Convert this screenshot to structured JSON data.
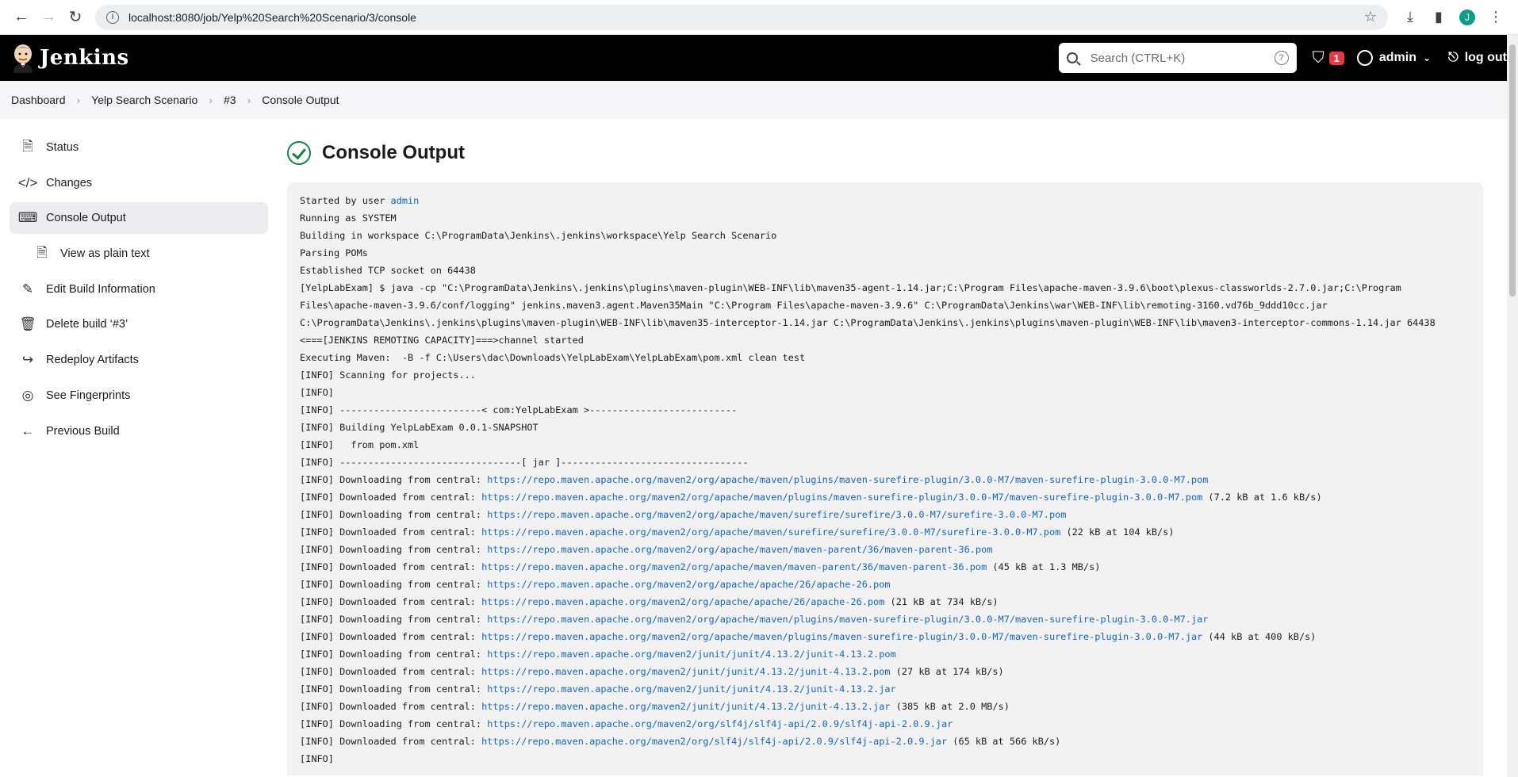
{
  "browser": {
    "url": "localhost:8080/job/Yelp%20Search%20Scenario/3/console",
    "profile_initial": "J"
  },
  "header": {
    "brand": "Jenkins",
    "search_placeholder": "Search (CTRL+K)",
    "alert_count": "1",
    "user": "admin",
    "logout": "log out"
  },
  "breadcrumb": [
    "Dashboard",
    "Yelp Search Scenario",
    "#3",
    "Console Output"
  ],
  "sidebar": {
    "items": [
      {
        "label": "Status",
        "icon": "document-icon"
      },
      {
        "label": "Changes",
        "icon": "code-icon"
      },
      {
        "label": "Console Output",
        "icon": "terminal-icon"
      },
      {
        "label": "View as plain text",
        "icon": "document-icon"
      },
      {
        "label": "Edit Build Information",
        "icon": "edit-icon"
      },
      {
        "label": "Delete build ‘#3’",
        "icon": "trash-icon"
      },
      {
        "label": "Redeploy Artifacts",
        "icon": "share-icon"
      },
      {
        "label": "See Fingerprints",
        "icon": "fingerprint-icon"
      },
      {
        "label": "Previous Build",
        "icon": "arrow-left-icon"
      }
    ]
  },
  "page": {
    "title": "Console Output",
    "status_color": "#138347"
  },
  "console": {
    "lines": [
      {
        "text": "Started by user ",
        "link": "admin",
        "suffix": ""
      },
      {
        "text": "Running as SYSTEM"
      },
      {
        "text": "Building in workspace C:\\ProgramData\\Jenkins\\.jenkins\\workspace\\Yelp Search Scenario"
      },
      {
        "text": "Parsing POMs"
      },
      {
        "text": "Established TCP socket on 64438"
      },
      {
        "text": "[YelpLabExam] $ java -cp \"C:\\ProgramData\\Jenkins\\.jenkins\\plugins\\maven-plugin\\WEB-INF\\lib\\maven35-agent-1.14.jar;C:\\Program Files\\apache-maven-3.9.6\\boot\\plexus-classworlds-2.7.0.jar;C:\\Program"
      },
      {
        "text": "Files\\apache-maven-3.9.6/conf/logging\" jenkins.maven3.agent.Maven35Main \"C:\\Program Files\\apache-maven-3.9.6\" C:\\ProgramData\\Jenkins\\war\\WEB-INF\\lib\\remoting-3160.vd76b_9ddd10cc.jar"
      },
      {
        "text": "C:\\ProgramData\\Jenkins\\.jenkins\\plugins\\maven-plugin\\WEB-INF\\lib\\maven35-interceptor-1.14.jar C:\\ProgramData\\Jenkins\\.jenkins\\plugins\\maven-plugin\\WEB-INF\\lib\\maven3-interceptor-commons-1.14.jar 64438"
      },
      {
        "text": "<===[JENKINS REMOTING CAPACITY]===>channel started"
      },
      {
        "text": "Executing Maven:  -B -f C:\\Users\\dac\\Downloads\\YelpLabExam\\YelpLabExam\\pom.xml clean test"
      },
      {
        "text": "[INFO] Scanning for projects..."
      },
      {
        "text": "[INFO]"
      },
      {
        "text": "[INFO] -------------------------< com:YelpLabExam >--------------------------"
      },
      {
        "text": "[INFO] Building YelpLabExam 0.0.1-SNAPSHOT"
      },
      {
        "text": "[INFO]   from pom.xml"
      },
      {
        "text": "[INFO] --------------------------------[ jar ]---------------------------------"
      },
      {
        "text": "[INFO] Downloading from central: ",
        "link": "https://repo.maven.apache.org/maven2/org/apache/maven/plugins/maven-surefire-plugin/3.0.0-M7/maven-surefire-plugin-3.0.0-M7.pom",
        "suffix": ""
      },
      {
        "text": "[INFO] Downloaded from central: ",
        "link": "https://repo.maven.apache.org/maven2/org/apache/maven/plugins/maven-surefire-plugin/3.0.0-M7/maven-surefire-plugin-3.0.0-M7.pom",
        "suffix": " (7.2 kB at 1.6 kB/s)"
      },
      {
        "text": "[INFO] Downloading from central: ",
        "link": "https://repo.maven.apache.org/maven2/org/apache/maven/surefire/surefire/3.0.0-M7/surefire-3.0.0-M7.pom",
        "suffix": ""
      },
      {
        "text": "[INFO] Downloaded from central: ",
        "link": "https://repo.maven.apache.org/maven2/org/apache/maven/surefire/surefire/3.0.0-M7/surefire-3.0.0-M7.pom",
        "suffix": " (22 kB at 104 kB/s)"
      },
      {
        "text": "[INFO] Downloading from central: ",
        "link": "https://repo.maven.apache.org/maven2/org/apache/maven/maven-parent/36/maven-parent-36.pom",
        "suffix": ""
      },
      {
        "text": "[INFO] Downloaded from central: ",
        "link": "https://repo.maven.apache.org/maven2/org/apache/maven/maven-parent/36/maven-parent-36.pom",
        "suffix": " (45 kB at 1.3 MB/s)"
      },
      {
        "text": "[INFO] Downloading from central: ",
        "link": "https://repo.maven.apache.org/maven2/org/apache/apache/26/apache-26.pom",
        "suffix": ""
      },
      {
        "text": "[INFO] Downloaded from central: ",
        "link": "https://repo.maven.apache.org/maven2/org/apache/apache/26/apache-26.pom",
        "suffix": " (21 kB at 734 kB/s)"
      },
      {
        "text": "[INFO] Downloading from central: ",
        "link": "https://repo.maven.apache.org/maven2/org/apache/maven/plugins/maven-surefire-plugin/3.0.0-M7/maven-surefire-plugin-3.0.0-M7.jar",
        "suffix": ""
      },
      {
        "text": "[INFO] Downloaded from central: ",
        "link": "https://repo.maven.apache.org/maven2/org/apache/maven/plugins/maven-surefire-plugin/3.0.0-M7/maven-surefire-plugin-3.0.0-M7.jar",
        "suffix": " (44 kB at 400 kB/s)"
      },
      {
        "text": "[INFO] Downloading from central: ",
        "link": "https://repo.maven.apache.org/maven2/junit/junit/4.13.2/junit-4.13.2.pom",
        "suffix": ""
      },
      {
        "text": "[INFO] Downloaded from central: ",
        "link": "https://repo.maven.apache.org/maven2/junit/junit/4.13.2/junit-4.13.2.pom",
        "suffix": " (27 kB at 174 kB/s)"
      },
      {
        "text": "[INFO] Downloading from central: ",
        "link": "https://repo.maven.apache.org/maven2/junit/junit/4.13.2/junit-4.13.2.jar",
        "suffix": ""
      },
      {
        "text": "[INFO] Downloaded from central: ",
        "link": "https://repo.maven.apache.org/maven2/junit/junit/4.13.2/junit-4.13.2.jar",
        "suffix": " (385 kB at 2.0 MB/s)"
      },
      {
        "text": "[INFO] Downloading from central: ",
        "link": "https://repo.maven.apache.org/maven2/org/slf4j/slf4j-api/2.0.9/slf4j-api-2.0.9.jar",
        "suffix": ""
      },
      {
        "text": "[INFO] Downloaded from central: ",
        "link": "https://repo.maven.apache.org/maven2/org/slf4j/slf4j-api/2.0.9/slf4j-api-2.0.9.jar",
        "suffix": " (65 kB at 566 kB/s)"
      },
      {
        "text": "[INFO]"
      }
    ]
  }
}
